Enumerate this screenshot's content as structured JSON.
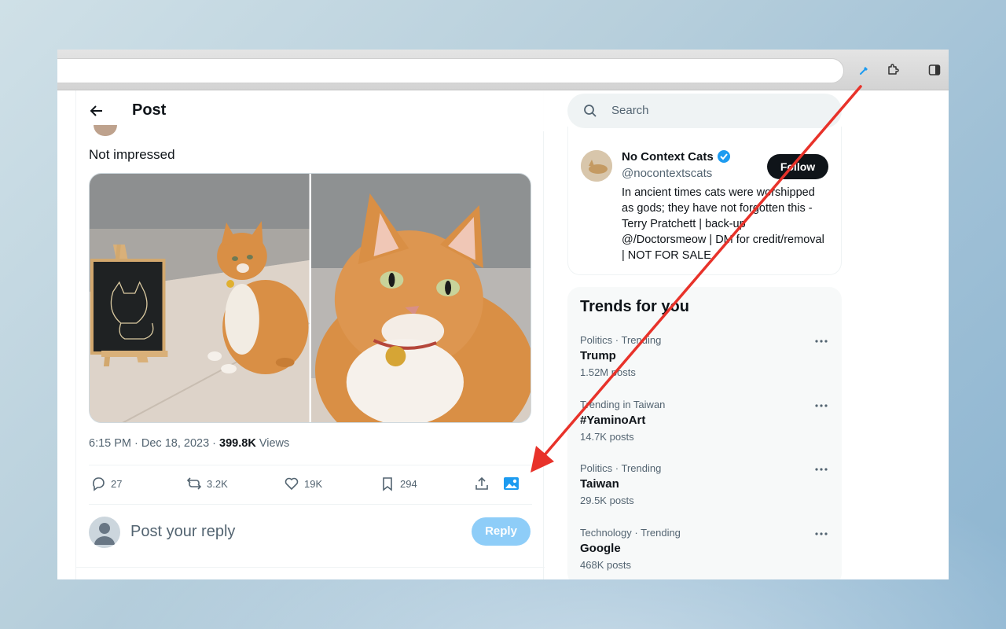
{
  "post": {
    "header_title": "Post",
    "text": "Not impressed",
    "time": "6:15 PM · Dec 18, 2023 · ",
    "views_count": "399.8K",
    "views_label": " Views",
    "actions": {
      "replies": "27",
      "reposts": "3.2K",
      "likes": "19K",
      "bookmarks": "294"
    },
    "reply_placeholder": "Post your reply",
    "reply_button": "Reply"
  },
  "sidebar": {
    "search_placeholder": "Search",
    "account": {
      "name": "No Context Cats",
      "handle": "@nocontextscats",
      "follow_label": "Follow",
      "bio": "In ancient times cats were worshipped as gods; they have not forgotten this - Terry Pratchett | back-up @/Doctorsmeow | DM for credit/removal | NOT FOR SALE"
    },
    "trends_title": "Trends for you",
    "trends": [
      {
        "category": "Politics · Trending",
        "name": "Trump",
        "count": "1.52M posts"
      },
      {
        "category": "Trending in Taiwan",
        "name": "#YaminoArt",
        "count": "14.7K posts"
      },
      {
        "category": "Politics · Trending",
        "name": "Taiwan",
        "count": "29.5K posts"
      },
      {
        "category": "Technology · Trending",
        "name": "Google",
        "count": "468K posts"
      }
    ]
  },
  "colors": {
    "accent": "#1d9bf0",
    "annotation_arrow": "#e8322a"
  }
}
